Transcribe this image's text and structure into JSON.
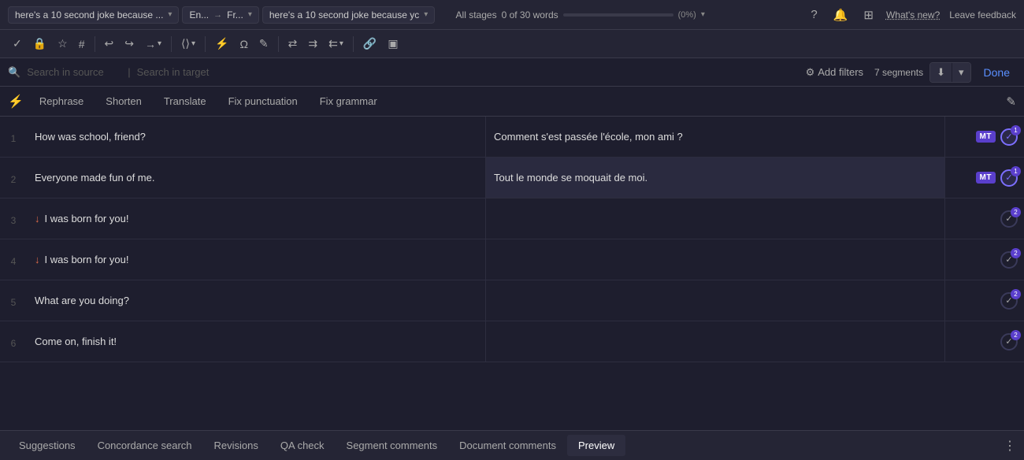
{
  "topbar": {
    "source_doc": "here's a 10 second joke because ...",
    "lang_pair_left": "En...",
    "lang_pair_arrow": "→",
    "lang_pair_right": "Fr...",
    "target_doc": "here's a 10 second joke because yc",
    "stages_label": "All stages",
    "word_count": "0 of 30 words",
    "pct": "(0%)",
    "whats_new": "What's new?",
    "leave_feedback": "Leave feedback"
  },
  "toolbar": {
    "done_label": "Done"
  },
  "searchbar": {
    "source_placeholder": "Search in source",
    "target_placeholder": "Search in target",
    "add_filters": "Add filters",
    "segments_count": "7 segments"
  },
  "ai_toolbar": {
    "tabs": [
      {
        "label": "Rephrase",
        "active": false
      },
      {
        "label": "Shorten",
        "active": false
      },
      {
        "label": "Translate",
        "active": false
      },
      {
        "label": "Fix punctuation",
        "active": false
      },
      {
        "label": "Fix grammar",
        "active": false
      }
    ]
  },
  "segments": [
    {
      "num": "1",
      "source": "How was school, friend?",
      "target": "Comment s'est passée l'école, mon ami ?",
      "has_mt": true,
      "checked": true,
      "badge": "1",
      "has_warning": false,
      "target_highlighted": false
    },
    {
      "num": "2",
      "source": "Everyone made fun of me.",
      "target": "Tout le monde se moquait de moi.",
      "has_mt": true,
      "checked": true,
      "badge": "1",
      "has_warning": false,
      "target_highlighted": true
    },
    {
      "num": "3",
      "source": "I was born for you!",
      "target": "",
      "has_mt": false,
      "checked": false,
      "badge": "2",
      "has_warning": true,
      "target_highlighted": false
    },
    {
      "num": "4",
      "source": "I was born for you!",
      "target": "",
      "has_mt": false,
      "checked": false,
      "badge": "2",
      "has_warning": true,
      "target_highlighted": false
    },
    {
      "num": "5",
      "source": "What are you doing?",
      "target": "",
      "has_mt": false,
      "checked": false,
      "badge": "2",
      "has_warning": false,
      "target_highlighted": false
    },
    {
      "num": "6",
      "source": "Come on, finish it!",
      "target": "",
      "has_mt": false,
      "checked": false,
      "badge": "2",
      "has_warning": false,
      "target_highlighted": false
    }
  ],
  "bottom_tabs": [
    {
      "label": "Suggestions",
      "active": false
    },
    {
      "label": "Concordance search",
      "active": false
    },
    {
      "label": "Revisions",
      "active": false
    },
    {
      "label": "QA check",
      "active": false
    },
    {
      "label": "Segment comments",
      "active": false
    },
    {
      "label": "Document comments",
      "active": false
    },
    {
      "label": "Preview",
      "active": true
    }
  ]
}
